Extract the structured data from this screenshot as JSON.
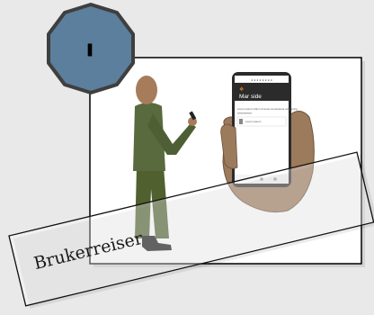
{
  "caption": {
    "text": "Brukerreiser"
  },
  "phone": {
    "logo": "❖",
    "status": "● ● ●  ● ● ● ●  ●",
    "header_title": "Mar   side",
    "body_text": "Lorem ipsum dolor sit amet consectetur adipiscing",
    "card_text": "Lorem ipsum"
  },
  "badge": {
    "glyph": "❚"
  },
  "colors": {
    "background": "#e9e9e9",
    "badge_fill": "#5b7f9c",
    "badge_stroke": "#3f3f3f",
    "person_body": "#586a3e",
    "skin": "#a67c5b",
    "hand": "#9c7a5c",
    "phone_frame": "#2b2b2b"
  }
}
